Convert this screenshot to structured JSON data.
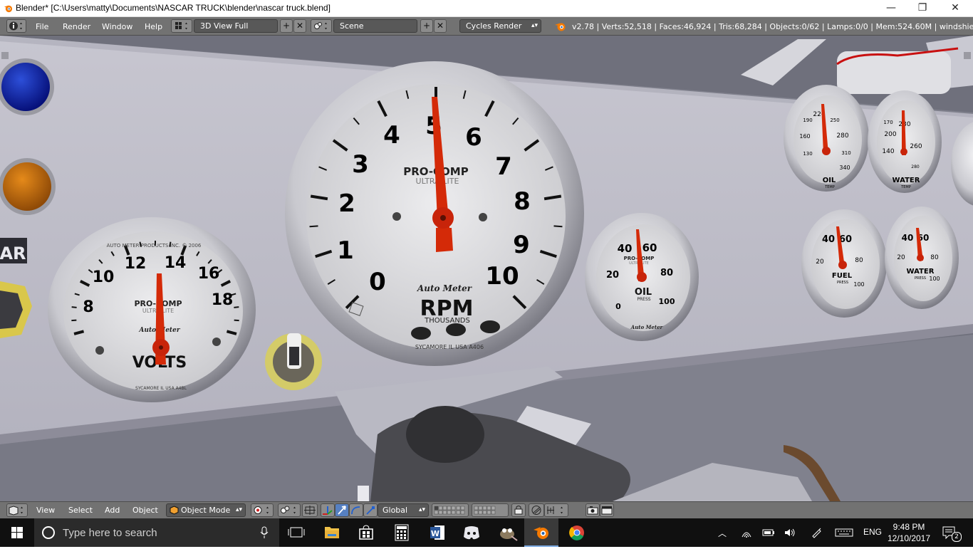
{
  "window": {
    "title": "Blender* [C:\\Users\\matty\\Documents\\NASCAR TRUCK\\blender\\nascar truck.blend]",
    "minimize": "—",
    "maximize": "❐",
    "close": "✕"
  },
  "infobar": {
    "menu": [
      "File",
      "Render",
      "Window",
      "Help"
    ],
    "layout": "3D View Full",
    "scene": "Scene",
    "engine": "Cycles Render",
    "stats": "v2.78 | Verts:52,518 | Faces:46,924 | Tris:68,284 | Objects:0/62 | Lamps:0/0 | Mem:524.60M | windshield_int"
  },
  "viewport": {
    "tach": {
      "numbers": [
        "0",
        "1",
        "2",
        "3",
        "4",
        "5",
        "6",
        "7",
        "8",
        "9",
        "10"
      ],
      "brand1": "PRO-COMP",
      "brand2": "ULTRA-LITE",
      "logo": "Auto Meter",
      "unit": "RPM",
      "subunit": "THOUSANDS",
      "fineprint": "SYCAMORE IL USA A406"
    },
    "volts": {
      "numbers": [
        "8",
        "10",
        "12",
        "14",
        "16",
        "18"
      ],
      "brand1": "PRO-COMP",
      "brand2": "ULTRA-LITE",
      "logo": "Auto Meter",
      "unit": "VOLTS",
      "topprint": "AUTO METER PRODUCTS INC. © 2006",
      "fineprint": "SYCAMORE IL USA A4BL"
    },
    "oil_press": {
      "numbers": [
        "0",
        "20",
        "40",
        "60",
        "80",
        "100"
      ],
      "brand1": "PRO-COMP",
      "brand2": "ULTRA-LITE",
      "unit": "OIL",
      "sub": "PRESS",
      "logo": "Auto Meter"
    },
    "oil_temp": {
      "numbers": [
        "130",
        "160",
        "190",
        "220",
        "250",
        "280",
        "310",
        "340"
      ],
      "unit": "OIL",
      "sub": "TEMP"
    },
    "water_temp": {
      "numbers": [
        "140",
        "170",
        "200",
        "230",
        "260",
        "280"
      ],
      "unit": "WATER",
      "sub": "TEMP"
    },
    "fuel_press": {
      "numbers": [
        "20",
        "40",
        "60",
        "80",
        "100"
      ],
      "unit": "FUEL",
      "sub": "PRESS"
    },
    "water_press": {
      "numbers": [
        "20",
        "40",
        "60",
        "80",
        "100"
      ],
      "unit": "WATER",
      "sub": "PRESS"
    },
    "side_label": "AR"
  },
  "v3dheader": {
    "menu": [
      "View",
      "Select",
      "Add",
      "Object"
    ],
    "mode": "Object Mode",
    "orientation": "Global"
  },
  "taskbar": {
    "search_placeholder": "Type here to search",
    "language": "ENG",
    "time": "9:48 PM",
    "date": "12/10/2017",
    "notifications": "2"
  },
  "colors": {
    "blender_header": "#727272",
    "needle": "#d42a08",
    "taskbar": "#101010"
  }
}
